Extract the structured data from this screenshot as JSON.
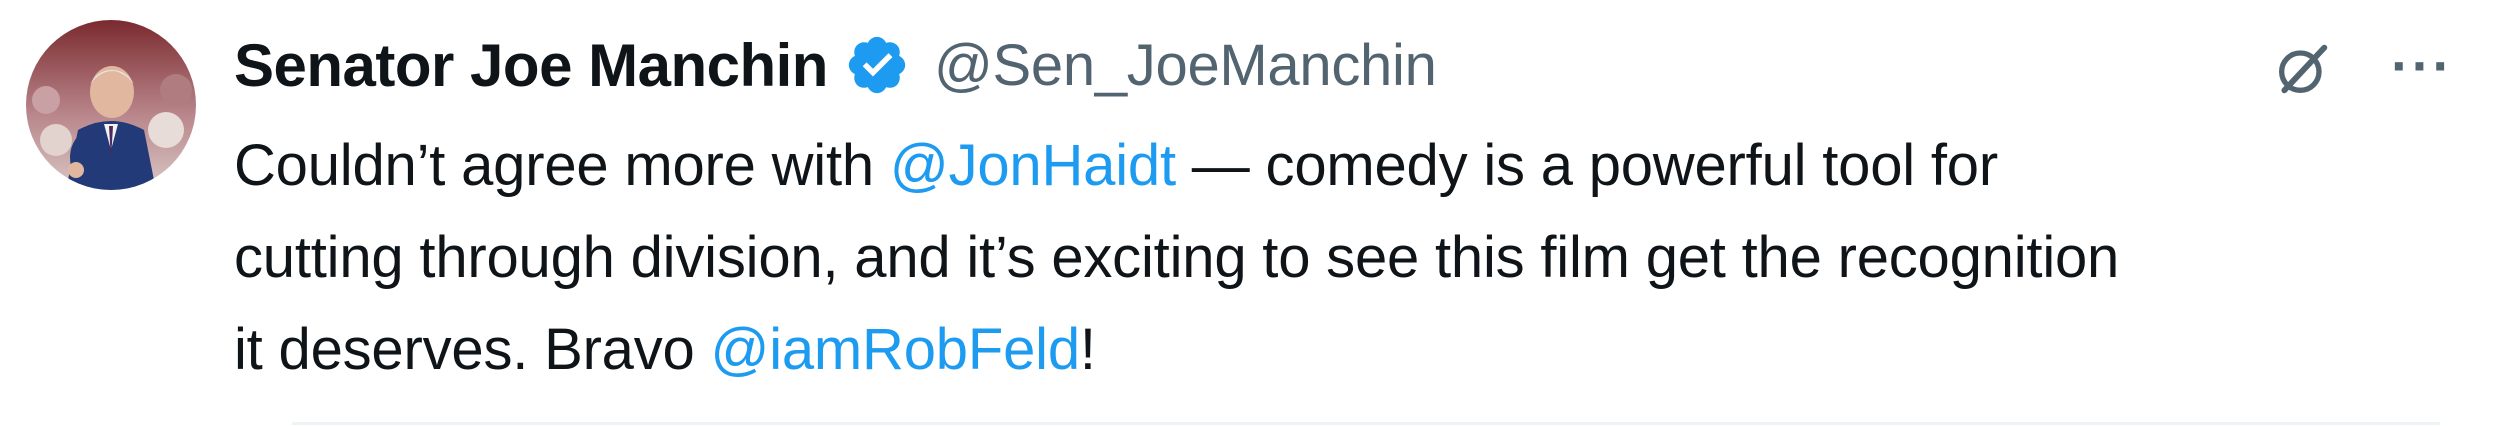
{
  "tweet": {
    "author": {
      "display_name": "Senator Joe Manchin",
      "handle": "@Sen_JoeManchin",
      "verified": true
    },
    "icons": {
      "verified": "verified-badge-icon",
      "grok": "grok-icon",
      "more": "more-icon"
    },
    "more_label": "···",
    "body": {
      "line1_pre": "Couldn’t agree more with ",
      "mention1": "@JonHaidt",
      "line1_post": " — comedy is a powerful tool for",
      "line2": "cutting through division, and it’s exciting to see this film get the recognition",
      "line3_pre": "it deserves. Bravo ",
      "mention2": "@iamRobFeld",
      "line3_post": "!"
    }
  },
  "colors": {
    "text": "#0f1419",
    "secondary": "#536471",
    "link": "#1d9bf0",
    "verified": "#1d9bf0",
    "divider": "#eff3f4"
  }
}
